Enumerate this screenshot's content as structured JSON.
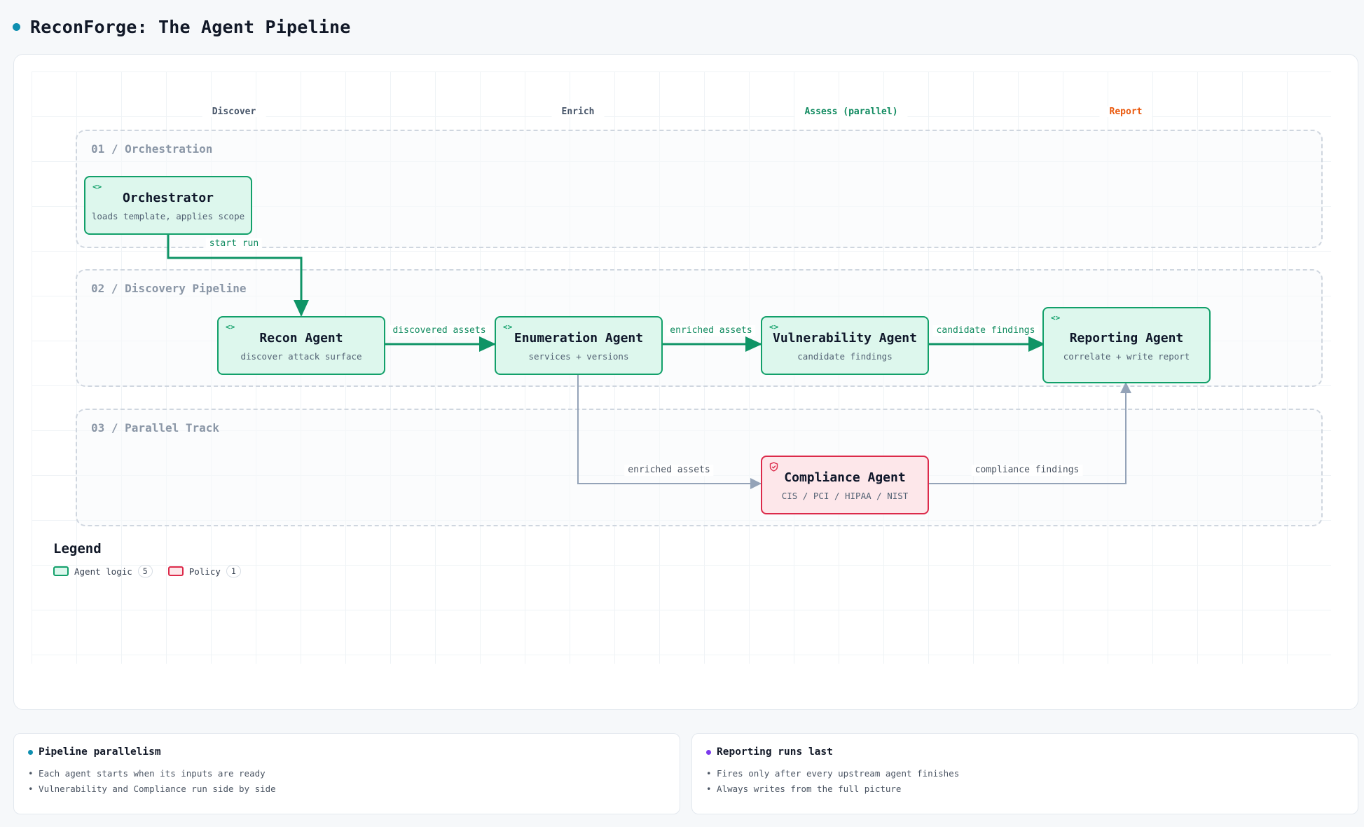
{
  "header": {
    "title": "ReconForge: The Agent Pipeline"
  },
  "stages": [
    {
      "label": "Discover",
      "color": "#475569"
    },
    {
      "label": "Enrich",
      "color": "#475569"
    },
    {
      "label": "Assess (parallel)",
      "color": "#0f8a5f"
    },
    {
      "label": "Report",
      "color": "#ea580c"
    }
  ],
  "lanes": [
    {
      "title": "01 / Orchestration"
    },
    {
      "title": "02 / Discovery Pipeline"
    },
    {
      "title": "03 / Parallel Track"
    }
  ],
  "nodes": {
    "orchestrator": {
      "title": "Orchestrator",
      "subtitle": "loads template, applies scope",
      "icon": "code-icon"
    },
    "recon": {
      "title": "Recon Agent",
      "subtitle": "discover attack surface",
      "icon": "code-icon"
    },
    "enumeration": {
      "title": "Enumeration Agent",
      "subtitle": "services + versions",
      "icon": "code-icon"
    },
    "vulnerability": {
      "title": "Vulnerability Agent",
      "subtitle": "candidate findings",
      "icon": "code-icon"
    },
    "reporting": {
      "title": "Reporting Agent",
      "subtitle": "correlate + write report",
      "icon": "code-icon"
    },
    "compliance": {
      "title": "Compliance Agent",
      "subtitle": "CIS / PCI / HIPAA / NIST",
      "icon": "shield-icon"
    }
  },
  "edges": {
    "start_run": "start run",
    "discovered_assets": "discovered assets",
    "enriched_assets_main": "enriched assets",
    "candidate_findings": "candidate findings",
    "enriched_assets_parallel": "enriched assets",
    "compliance_findings": "compliance findings"
  },
  "legend": {
    "title": "Legend",
    "items": [
      {
        "label": "Agent logic",
        "count": "5"
      },
      {
        "label": "Policy",
        "count": "1"
      }
    ]
  },
  "notes": [
    {
      "title": "Pipeline parallelism",
      "dot_color": "#0e8fb0",
      "items": [
        "• Each agent starts when its inputs are ready",
        "• Vulnerability and Compliance run side by side"
      ]
    },
    {
      "title": "Reporting runs last",
      "dot_color": "#7c3aed",
      "items": [
        "• Fires only after every upstream agent finishes",
        "• Always writes from the full picture"
      ]
    }
  ],
  "colors": {
    "agent_border": "#12a06a",
    "agent_fill": "#ddf7ed",
    "policy_border": "#dc2a4a",
    "policy_fill": "#fde7ea",
    "flow_edge": "#0f9466",
    "parallel_edge": "#94a3b8"
  }
}
